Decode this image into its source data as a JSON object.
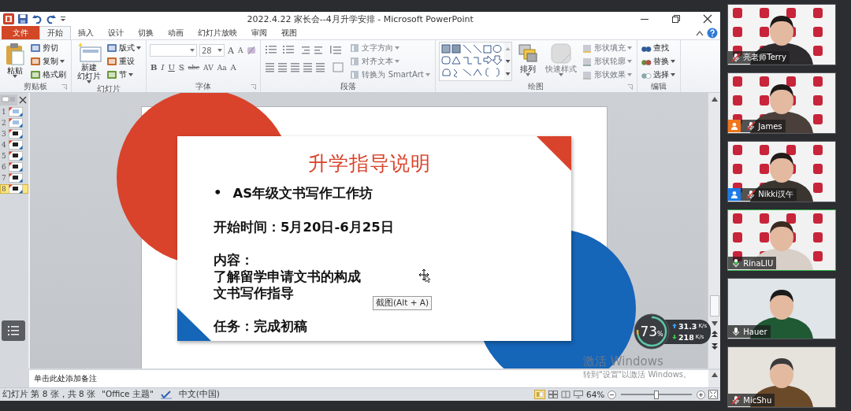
{
  "window": {
    "title": "2022.4.22 家长会--4月升学安排 - Microsoft PowerPoint"
  },
  "tabs": [
    {
      "label": "文件",
      "kind": "file",
      "selected": false
    },
    {
      "label": "开始",
      "kind": "tab",
      "selected": true
    },
    {
      "label": "插入",
      "kind": "tab",
      "selected": false
    },
    {
      "label": "设计",
      "kind": "tab",
      "selected": false
    },
    {
      "label": "切换",
      "kind": "tab",
      "selected": false
    },
    {
      "label": "动画",
      "kind": "tab",
      "selected": false
    },
    {
      "label": "幻灯片放映",
      "kind": "tab",
      "selected": false
    },
    {
      "label": "审阅",
      "kind": "tab",
      "selected": false
    },
    {
      "label": "视图",
      "kind": "tab",
      "selected": false
    }
  ],
  "ribbon": {
    "groups": [
      {
        "label": "剪贴板",
        "kind": "clipboard",
        "big": {
          "lines": [
            "粘贴"
          ]
        },
        "items": [
          {
            "label": "剪切",
            "disabled": false,
            "menu": false
          },
          {
            "label": "复制",
            "disabled": false,
            "menu": true
          },
          {
            "label": "格式刷",
            "disabled": false,
            "menu": false
          }
        ]
      },
      {
        "label": "幻灯片",
        "kind": "slides",
        "big": {
          "lines": [
            "新建",
            "幻灯片"
          ]
        },
        "items": [
          {
            "label": "版式",
            "disabled": false,
            "menu": true
          },
          {
            "label": "重设",
            "disabled": false,
            "menu": false
          },
          {
            "label": "节",
            "disabled": false,
            "menu": true
          }
        ]
      },
      {
        "label": "字体",
        "kind": "font",
        "size": "28",
        "top_buttons": [
          "A",
          "A"
        ],
        "buttons": [
          "B",
          "I",
          "U",
          "S",
          "abc",
          "AV",
          "Aa",
          "A"
        ]
      },
      {
        "label": "段落",
        "kind": "paragraph",
        "items": [
          {
            "label": "文字方向",
            "disabled": true,
            "menu": true
          },
          {
            "label": "对齐文本",
            "disabled": true,
            "menu": true
          },
          {
            "label": "转换为 SmartArt",
            "disabled": true,
            "menu": true
          }
        ]
      },
      {
        "label": "绘图",
        "kind": "drawing",
        "big_buttons": [
          {
            "lines": [
              "排列"
            ],
            "disabled": false
          },
          {
            "lines": [
              "快速样式"
            ],
            "disabled": true
          }
        ],
        "items": [
          {
            "label": "形状填充",
            "disabled": true,
            "menu": true
          },
          {
            "label": "形状轮廓",
            "disabled": true,
            "menu": true
          },
          {
            "label": "形状效果",
            "disabled": true,
            "menu": true
          }
        ]
      },
      {
        "label": "编辑",
        "kind": "editing",
        "items": [
          {
            "label": "查找",
            "disabled": false,
            "menu": false
          },
          {
            "label": "替换",
            "disabled": false,
            "menu": true
          },
          {
            "label": "选择",
            "disabled": false,
            "menu": true
          }
        ]
      }
    ]
  },
  "thumbnails": [
    {
      "number": "1",
      "selected": false
    },
    {
      "number": "2",
      "selected": false
    },
    {
      "number": "3",
      "selected": false
    },
    {
      "number": "4",
      "selected": false
    },
    {
      "number": "5",
      "selected": false
    },
    {
      "number": "6",
      "selected": false
    },
    {
      "number": "7",
      "selected": false
    },
    {
      "number": "8",
      "selected": true
    }
  ],
  "slide": {
    "title": "升学指导说明",
    "bullet": "•",
    "paragraphs": [
      {
        "kind": "bullet",
        "lines": [
          "AS年级文书写作工作坊"
        ]
      },
      {
        "kind": "plain",
        "lines": [
          "开始时间：5月20日-6月25日"
        ]
      },
      {
        "kind": "plain",
        "lines": [
          "内容：",
          "了解留学申请文书的构成",
          "文书写作指导"
        ]
      },
      {
        "kind": "plain",
        "lines": [
          "任务：完成初稿"
        ]
      }
    ]
  },
  "tooltip": "截图(Alt + A)",
  "network_meter": {
    "percent": "73",
    "unit": "%",
    "upload": "31.3",
    "upload_unit": "K/s",
    "download": "218",
    "download_unit": "K/s"
  },
  "notes": {
    "placeholder": "单击此处添加备注"
  },
  "activation": {
    "title": "激活 Windows",
    "hint": "转到\"设置\"以激活 Windows。"
  },
  "status_bar": {
    "slide": "幻灯片 第 8 张，共 8 张",
    "theme": "\"Office 主题\"",
    "language": "中文(中国)",
    "zoom": "64%",
    "zoom_slider": {
      "level": 0.5
    }
  },
  "participants": [
    {
      "name": "亮老师Terry",
      "muted": true,
      "speaking": false
    },
    {
      "name": "James",
      "muted": true,
      "speaking": false,
      "color": "#f0761c"
    },
    {
      "name": "Nikki汉午",
      "muted": true,
      "speaking": false,
      "color": "#1c7ce8"
    },
    {
      "name": "RinaLIU",
      "muted": false,
      "speaking": true
    },
    {
      "name": "Hauer",
      "muted": false,
      "speaking": false
    },
    {
      "name": "MicShu",
      "muted": true,
      "speaking": false
    }
  ]
}
